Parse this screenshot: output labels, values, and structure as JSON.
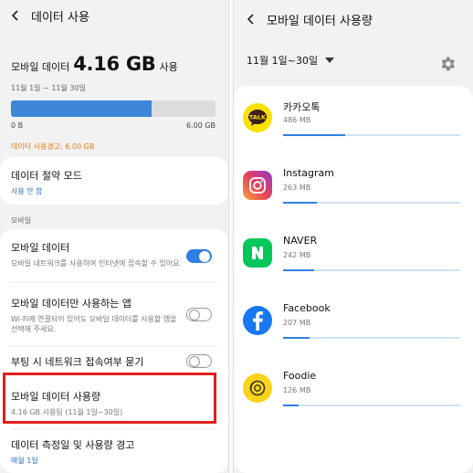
{
  "left": {
    "header_title": "데이터 사용",
    "usage_label": "모바일 데이터",
    "usage_amount": "4.16 GB",
    "usage_suffix": "사용",
    "period": "11월 1일 ~ 11월 30일",
    "bar_fill_fraction": 0.687,
    "bar_min": "0 B",
    "bar_max": "6.00 GB",
    "warning": "데이터 사용경고: 6.00 GB",
    "saver": {
      "title": "데이터 절약 모드",
      "status": "사용 안 함"
    },
    "section_label": "모바일",
    "mobile_data": {
      "title": "모바일 데이터",
      "desc": "모바일 네트워크를 사용하여 인터넷에 접속할 수 있어요.",
      "enabled": true
    },
    "mobile_only_apps": {
      "title": "모바일 데이터만 사용하는 앱",
      "desc": "Wi-Fi에 연결되어 있어도 모바일 데이터를 사용할 앱을 선택해 주세요.",
      "enabled": false
    },
    "boot_ask": {
      "title": "부팅 시 네트워크 접속여부 묻기",
      "enabled": false
    },
    "usage_item": {
      "title": "모바일 데이터 사용량",
      "sub": "4.16 GB 사용됨 (11월 1일~30일)"
    },
    "cycle_item": {
      "title": "데이터 측정일 및 사용량 경고",
      "sub": "매월 1일"
    }
  },
  "right": {
    "header_title": "모바일 데이터 사용량",
    "period": "11월 1일~30일",
    "apps": [
      {
        "name": "카카오톡",
        "size": "486 MB",
        "fraction": 0.35,
        "icon": "kakaotalk-icon"
      },
      {
        "name": "Instagram",
        "size": "263 MB",
        "fraction": 0.19,
        "icon": "instagram-icon"
      },
      {
        "name": "NAVER",
        "size": "242 MB",
        "fraction": 0.175,
        "icon": "naver-icon"
      },
      {
        "name": "Facebook",
        "size": "207 MB",
        "fraction": 0.15,
        "icon": "facebook-icon"
      },
      {
        "name": "Foodie",
        "size": "126 MB",
        "fraction": 0.09,
        "icon": "foodie-icon"
      }
    ]
  },
  "colors": {
    "accent_blue": "#2f7fe0",
    "warning_orange": "#e3791b",
    "highlight_red": "#e31d1d",
    "kakao_yellow": "#fae100",
    "naver_green": "#03c75a",
    "facebook_blue": "#1877f2",
    "foodie_yellow": "#f9d21a"
  }
}
